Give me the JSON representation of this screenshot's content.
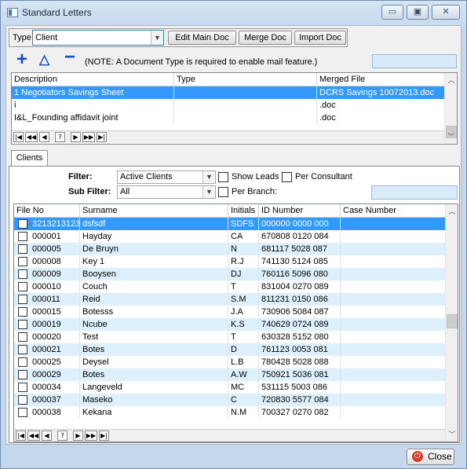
{
  "window": {
    "title": "Standard Letters",
    "controls": [
      "minimize-icon",
      "maximize-icon",
      "close-icon"
    ]
  },
  "toolbar": {
    "type_label": "Type",
    "type_value": "Client",
    "edit_main_doc": "Edit Main Doc",
    "merge_doc": "Merge Doc",
    "import_doc": "Import Doc"
  },
  "doc_actions": {
    "icons": [
      "add-icon",
      "edit-icon",
      "remove-icon"
    ],
    "note": "(NOTE: A Document Type is required to enable mail feature.)"
  },
  "documents": {
    "columns": [
      "Description",
      "Type",
      "Merged File"
    ],
    "rows": [
      {
        "description": "1 Negotiators Savings Sheet",
        "type": "",
        "merged_file": "DCRS Savings 10072013.doc",
        "selected": true
      },
      {
        "description": "i",
        "type": "",
        "merged_file": ".doc",
        "selected": false
      },
      {
        "description": "I&L_Founding affidavit joint",
        "type": "",
        "merged_file": ".doc",
        "selected": false
      }
    ],
    "nav": [
      "|◀",
      "◀◀",
      "◀",
      "?",
      "▶",
      "▶▶",
      "▶|"
    ]
  },
  "tabs": {
    "clients": "Clients"
  },
  "filters": {
    "filter_label": "Filter:",
    "filter_value": "Active Clients",
    "sub_filter_label": "Sub Filter:",
    "sub_filter_value": "All",
    "show_leads": "Show Leads",
    "per_consultant": "Per Consultant",
    "per_branch": "Per Branch:",
    "icons": [
      "search-icon",
      "chat-icon"
    ]
  },
  "clients": {
    "columns": [
      "File No",
      "Surname",
      "Initials",
      "ID Number",
      "Case Number"
    ],
    "rows": [
      {
        "file_no": "3213213123",
        "surname": "dsfsdf",
        "initials": "SDFS",
        "id_number": "000000 0000 000",
        "case_number": "",
        "selected": true
      },
      {
        "file_no": "000001",
        "surname": "Hayday",
        "initials": "CA",
        "id_number": "670808 0120 084",
        "case_number": ""
      },
      {
        "file_no": "000005",
        "surname": "De Bruyn",
        "initials": "N",
        "id_number": "681117 5028 087",
        "case_number": ""
      },
      {
        "file_no": "000008",
        "surname": "Key 1",
        "initials": "R.J",
        "id_number": "741130 5124 085",
        "case_number": ""
      },
      {
        "file_no": "000009",
        "surname": "Booysen",
        "initials": "DJ",
        "id_number": "760116 5096 080",
        "case_number": ""
      },
      {
        "file_no": "000010",
        "surname": "Couch",
        "initials": "T",
        "id_number": "831004 0270 089",
        "case_number": ""
      },
      {
        "file_no": "000011",
        "surname": "Reid",
        "initials": "S.M",
        "id_number": "811231 0150 086",
        "case_number": ""
      },
      {
        "file_no": "000015",
        "surname": "Botesss",
        "initials": "J.A",
        "id_number": "730906 5084 087",
        "case_number": ""
      },
      {
        "file_no": "000019",
        "surname": "Ncube",
        "initials": "K.S",
        "id_number": "740629 0724 089",
        "case_number": ""
      },
      {
        "file_no": "000020",
        "surname": "Test",
        "initials": "T",
        "id_number": "630328 5152 080",
        "case_number": ""
      },
      {
        "file_no": "000021",
        "surname": "Botes",
        "initials": "D",
        "id_number": "761123 0053 081",
        "case_number": ""
      },
      {
        "file_no": "000025",
        "surname": "Deysel",
        "initials": "L.B",
        "id_number": "780428 5028 088",
        "case_number": ""
      },
      {
        "file_no": "000029",
        "surname": "Botes",
        "initials": "A.W",
        "id_number": "750921 5036 081",
        "case_number": ""
      },
      {
        "file_no": "000034",
        "surname": "Langeveld",
        "initials": "MC",
        "id_number": "531115 5003 086",
        "case_number": ""
      },
      {
        "file_no": "000037",
        "surname": "Maseko",
        "initials": "C",
        "id_number": "720830 5577 084",
        "case_number": ""
      },
      {
        "file_no": "000038",
        "surname": "Kekana",
        "initials": "N.M",
        "id_number": "700327 0270 082",
        "case_number": ""
      }
    ],
    "nav": [
      "|◀",
      "◀◀",
      "◀",
      "?",
      "▶",
      "▶▶",
      "▶|"
    ]
  },
  "footer": {
    "close": "Close"
  },
  "colors": {
    "selection": "#3399ff",
    "alt_row": "#ddf0fb",
    "accent": "#1a4fbf"
  }
}
